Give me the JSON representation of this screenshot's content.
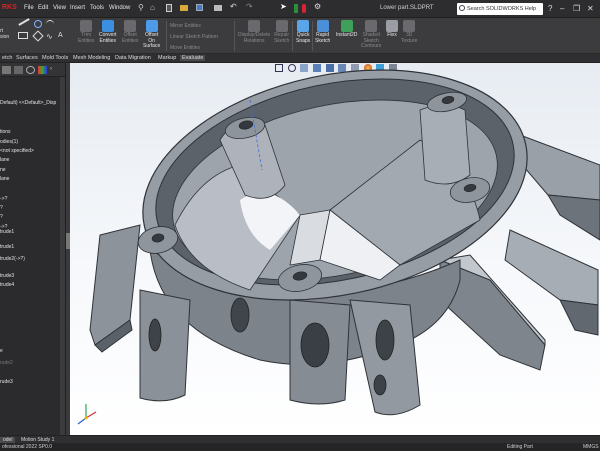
{
  "app": {
    "brand": "RKS",
    "doc_title": "Lower part.SLDPRT"
  },
  "menu": [
    "File",
    "Edit",
    "View",
    "Insert",
    "Tools",
    "Window"
  ],
  "search": {
    "placeholder": "Search SOLIDWORKS Help"
  },
  "window_controls": [
    "?",
    "–",
    "❐",
    "✕"
  ],
  "ribbon": {
    "sketch_left": "rt\nsion",
    "buttons": [
      {
        "label": "Trim\nEntities",
        "icon": "trim-icon",
        "dim": true
      },
      {
        "label": "Convert\nEntities",
        "icon": "convert-icon",
        "dim": false
      },
      {
        "label": "Offset\nEntities",
        "icon": "offset-icon",
        "dim": true
      },
      {
        "label": "Offset\nOn\nSurface",
        "icon": "offset-surface-icon",
        "dim": false
      },
      {
        "label": "Display/Delete\nRelations",
        "icon": "relations-icon",
        "dim": true
      },
      {
        "label": "Repair\nSketch",
        "icon": "repair-icon",
        "dim": true
      },
      {
        "label": "Quick\nSnaps",
        "icon": "snaps-icon",
        "dim": false
      },
      {
        "label": "Rapid\nSketch",
        "icon": "rapid-sketch-icon",
        "dim": false
      },
      {
        "label": "Instant2D",
        "icon": "instant2d-icon",
        "dim": false
      },
      {
        "label": "Shaded\nSketch\nContours",
        "icon": "shaded-contours-icon",
        "dim": true
      },
      {
        "label": "Flex",
        "icon": "flex-icon",
        "dim": false
      },
      {
        "label": "3D\nTexture",
        "icon": "texture-icon",
        "dim": true
      }
    ],
    "small_commands": [
      "Mirror Entities",
      "Linear Sketch Pattern",
      "Move Entities"
    ]
  },
  "tabs": [
    "etch",
    "Surfaces",
    "Mold Tools",
    "Mesh Modeling",
    "Data Migration",
    "Markup",
    "Evaluate"
  ],
  "tree": {
    "items": [
      {
        "text": "Default) <<Default>_Disp",
        "dim": false
      },
      {
        "text": "tions",
        "dim": false
      },
      {
        "text": "odies(1)",
        "dim": false
      },
      {
        "text": "<not specified>",
        "dim": false
      },
      {
        "text": "lane",
        "dim": false
      },
      {
        "text": "ne",
        "dim": false
      },
      {
        "text": "lane",
        "dim": false
      },
      {
        "text": "->?",
        "dim": false
      },
      {
        "text": "?",
        "dim": false
      },
      {
        "text": "?",
        "dim": false
      },
      {
        "text": "->?",
        "dim": false
      },
      {
        "text": "trude1",
        "dim": false
      },
      {
        "text": "trude1",
        "dim": false
      },
      {
        "text": "trude2(->?)",
        "dim": false
      },
      {
        "text": "trude3",
        "dim": false
      },
      {
        "text": "trude4",
        "dim": false
      },
      {
        "text": "e",
        "dim": false
      },
      {
        "text": "rude2",
        "dim": true
      },
      {
        "text": "rude3",
        "dim": false
      }
    ]
  },
  "bottom_tabs": [
    "odel",
    "Motion Study 1"
  ],
  "status": {
    "left": "ofessional 2022 SP0.0",
    "middle": "Editing Part",
    "right": "MMGS"
  },
  "colors": {
    "model_face": "#8a9099",
    "model_dark": "#4f545b",
    "model_light": "#c7ccd3",
    "accent_red": "#e02020"
  }
}
